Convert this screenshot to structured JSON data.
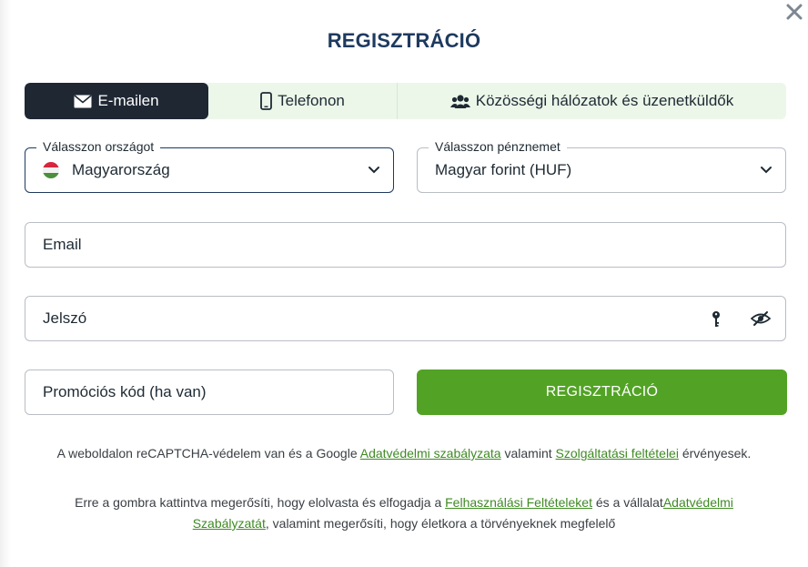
{
  "dialog": {
    "title": "REGISZTRÁCIÓ",
    "close_icon": "close-icon"
  },
  "tabs": [
    {
      "label": "E-mailen",
      "icon": "envelope-icon",
      "active": true
    },
    {
      "label": "Telefonon",
      "icon": "mobile-phone-icon",
      "active": false
    },
    {
      "label": "Közösségi hálózatok és üzenetküldők",
      "icon": "users-icon",
      "active": false
    }
  ],
  "country": {
    "legend": "Válasszon országot",
    "value": "Magyarország",
    "flag_icon": "hungary-flag-icon"
  },
  "currency": {
    "legend": "Válasszon pénznemet",
    "value": "Magyar forint (HUF)"
  },
  "email": {
    "placeholder": "Email"
  },
  "password": {
    "placeholder": "Jelszó",
    "icons": [
      "key-icon",
      "eye-slash-icon"
    ]
  },
  "promo": {
    "placeholder": "Promóciós kód (ha van)"
  },
  "submit": {
    "label": "REGISZTRÁCIÓ"
  },
  "recaptcha_note": {
    "prefix": "A weboldalon reCAPTCHA-védelem van és a Google ",
    "privacy_link": "Adatvédelmi szabályzata",
    "middle": " valamint ",
    "terms_link": "Szolgáltatási feltételei",
    "suffix": " érvényesek."
  },
  "consent_note": {
    "prefix": "Erre a gombra kattintva megerősíti, hogy elolvasta és elfogadja a ",
    "terms_link": "Felhasználási Feltételeket",
    "middle": " és a vállalat",
    "privacy_link": "Adatvédelmi Szabályzatát",
    "suffix": ", valamint megerősíti, hogy életkora a törvényeknek megfelelő"
  },
  "colors": {
    "title": "#1e3a5f",
    "tab_active_bg": "#1f2733",
    "tab_bg": "#ecf7ea",
    "submit_bg": "#52a325",
    "link": "#3f8a24"
  }
}
